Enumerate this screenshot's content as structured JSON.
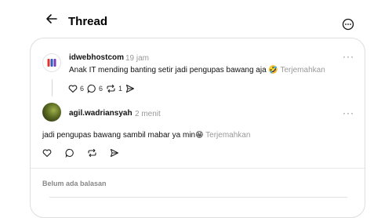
{
  "header": {
    "title": "Thread"
  },
  "post": {
    "author": "idwebhostcom",
    "time": "19 jam",
    "text": "Anak IT mending banting setir jadi pengupas bawang aja 🤣",
    "translate": "Terjemahkan",
    "likes": "6",
    "replies": "6",
    "reposts": "1"
  },
  "reply": {
    "author": "agil.wadriansyah",
    "time": "2 menit",
    "text": "jadi pengupas bawang sambil mabar ya min😁",
    "translate": "Terjemahkan"
  },
  "footer": {
    "no_replies": "Belum ada balasan"
  },
  "colors": {
    "muted": "#999999",
    "border": "#dedede"
  }
}
